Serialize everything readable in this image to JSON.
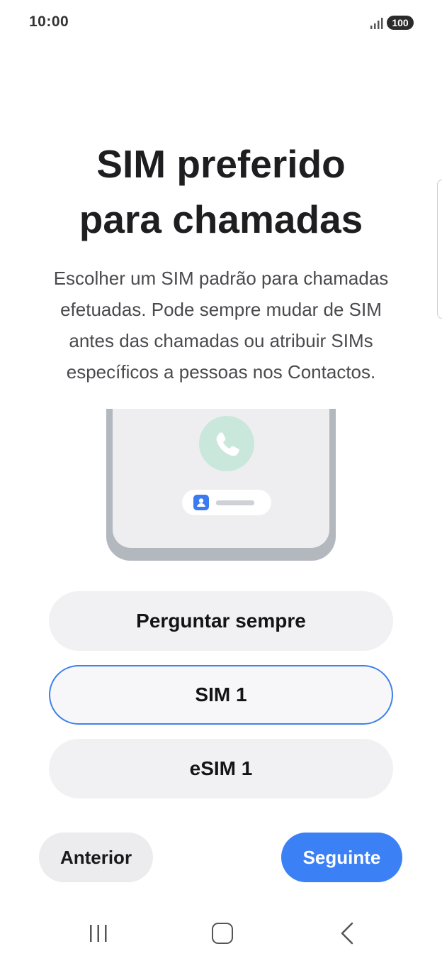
{
  "status_bar": {
    "time": "10:00",
    "battery": "100"
  },
  "title": {
    "line1": "SIM preferido",
    "line2": "para chamadas"
  },
  "description": "Escolher um SIM padrão para chamadas efetuadas. Pode sempre mudar de SIM antes das chamadas ou atribuir SIMs específicos a pessoas nos Contactos.",
  "illustration": {
    "icons": [
      "phone-call-icon",
      "contact-icon"
    ]
  },
  "options": [
    {
      "label": "Perguntar sempre",
      "selected": false
    },
    {
      "label": "SIM 1",
      "selected": true
    },
    {
      "label": "eSIM 1",
      "selected": false
    }
  ],
  "buttons": {
    "previous": "Anterior",
    "next": "Seguinte"
  },
  "navbar": {
    "icons": [
      "recents-icon",
      "home-icon",
      "back-icon"
    ]
  },
  "colors": {
    "accent": "#3b80f5",
    "selected_border": "#3f82e8",
    "call_circle": "#c9e7da"
  }
}
